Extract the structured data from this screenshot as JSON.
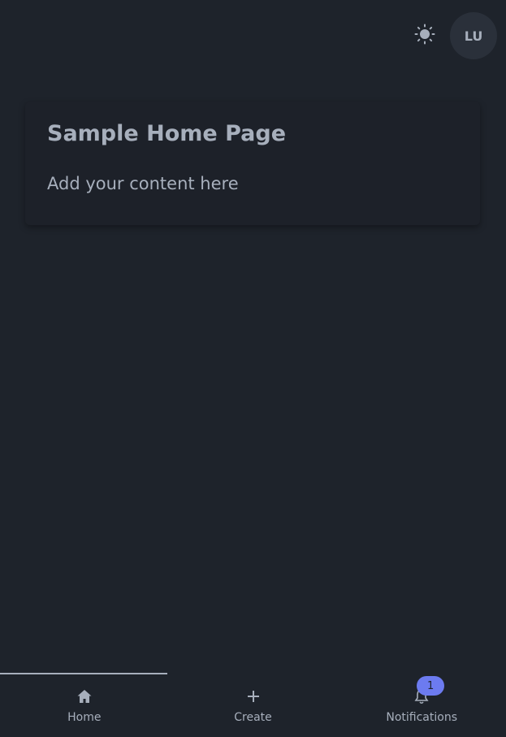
{
  "header": {
    "avatar_initials": "LU"
  },
  "card": {
    "title": "Sample Home Page",
    "body": "Add your content here"
  },
  "bottom_nav": {
    "items": [
      {
        "label": "Home",
        "icon": "home-icon",
        "active": true
      },
      {
        "label": "Create",
        "icon": "plus-icon",
        "active": false
      },
      {
        "label": "Notifications",
        "icon": "bell-icon",
        "active": false,
        "badge": "1"
      }
    ]
  },
  "colors": {
    "background": "#1e232b",
    "card": "#1d2129",
    "text": "#a7afbc",
    "badge": "#6c7bf0"
  }
}
